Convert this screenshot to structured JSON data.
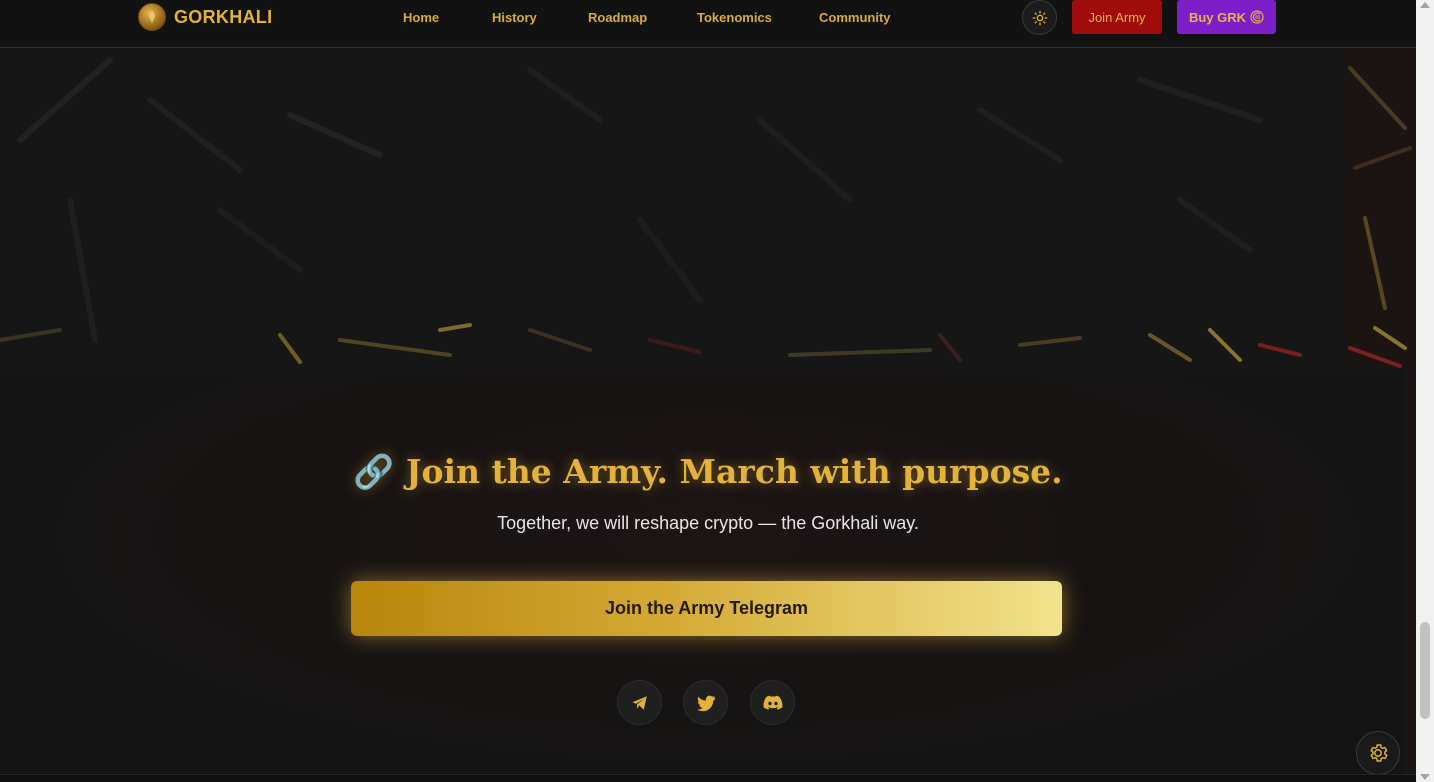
{
  "brand": {
    "name": "GORKHALI"
  },
  "nav": {
    "links": [
      "Home",
      "History",
      "Roadmap",
      "Tokenomics",
      "Community"
    ],
    "join_label": "Join Army",
    "buy_label": "Buy GRK"
  },
  "cta": {
    "title": "🔗 Join the Army. March with purpose.",
    "subtitle": "Together, we will reshape crypto — the Gorkhali way.",
    "button_label": "Join the Army Telegram"
  },
  "social": [
    "telegram-icon",
    "twitter-icon",
    "discord-icon"
  ],
  "colors": {
    "gold": "#e2b23a",
    "join_red": "#a00c0c",
    "buy_purple": "#7c1fc9",
    "background": "#141414"
  }
}
